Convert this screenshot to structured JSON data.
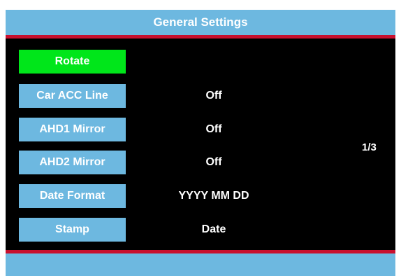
{
  "header": {
    "title": "General Settings"
  },
  "settings": [
    {
      "label": "Rotate",
      "value": "",
      "selected": true
    },
    {
      "label": "Car ACC Line",
      "value": "Off",
      "selected": false
    },
    {
      "label": "AHD1 Mirror",
      "value": "Off",
      "selected": false
    },
    {
      "label": "AHD2 Mirror",
      "value": "Off",
      "selected": false
    },
    {
      "label": "Date Format",
      "value": "YYYY MM DD",
      "selected": false
    },
    {
      "label": "Stamp",
      "value": "Date",
      "selected": false
    }
  ],
  "page": {
    "indicator": "1/3"
  },
  "colors": {
    "header_bg": "#6db8e0",
    "selected_bg": "#00e61a",
    "accent_line": "#c8102e",
    "screen_bg": "#000000"
  }
}
